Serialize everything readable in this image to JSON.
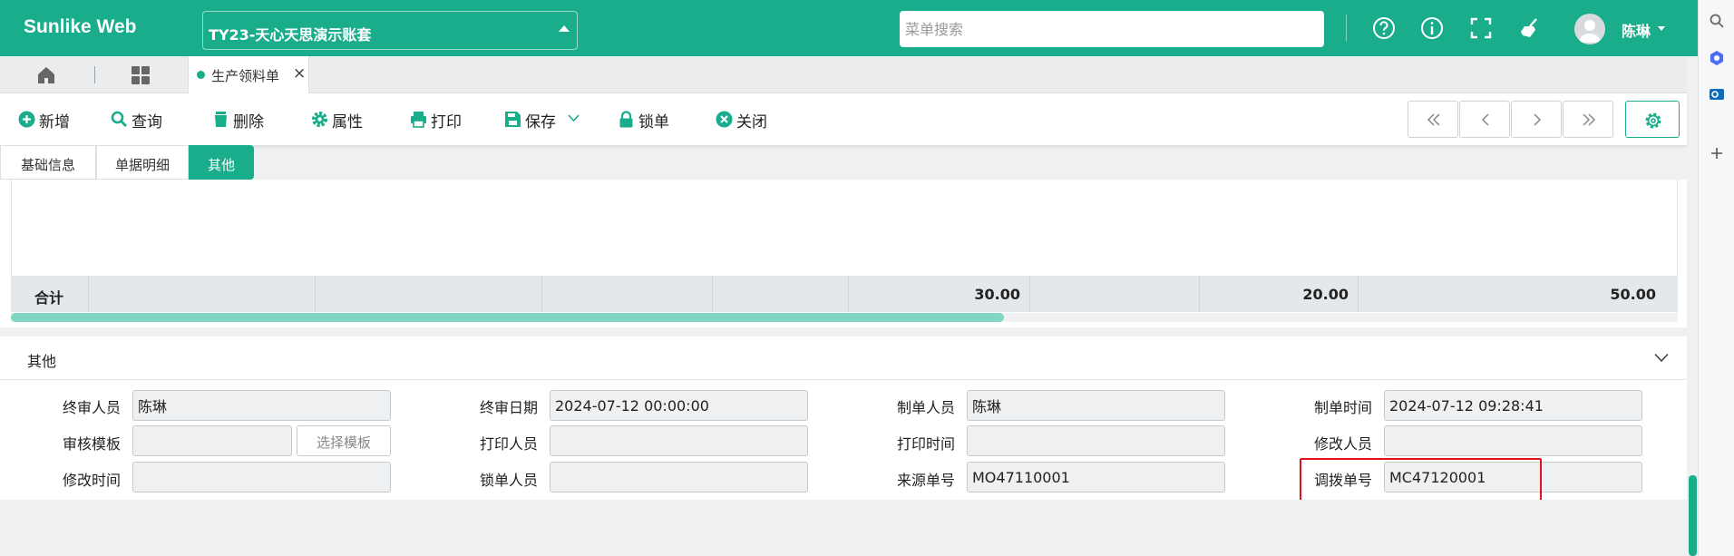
{
  "header": {
    "app_title": "Sunlike Web",
    "account_set": "TY23-天心天思演示账套",
    "search_placeholder": "菜单搜索",
    "user_name": "陈琳",
    "icons": [
      "help-icon",
      "info-icon",
      "fullscreen-icon",
      "clear-cache-icon",
      "avatar-icon"
    ]
  },
  "tabs": {
    "open_tab_label": "生产领料单",
    "close_glyph": "×"
  },
  "toolbar": {
    "new_label": "新增",
    "query_label": "查询",
    "delete_label": "删除",
    "property_label": "属性",
    "print_label": "打印",
    "save_label": "保存",
    "lock_label": "锁单",
    "close_label": "关闭"
  },
  "section_tabs": {
    "basic": "基础信息",
    "detail": "单据明细",
    "other": "其他",
    "active": "其他"
  },
  "grid": {
    "total_label": "合计",
    "total_values": [
      "30.00",
      "20.00",
      "50.00"
    ]
  },
  "other_section": {
    "title": "其他",
    "fields": {
      "final_reviewer": {
        "label": "终审人员",
        "value": "陈琳"
      },
      "final_review_date": {
        "label": "终审日期",
        "value": "2024-07-12 00:00:00"
      },
      "creator": {
        "label": "制单人员",
        "value": "陈琳"
      },
      "create_time": {
        "label": "制单时间",
        "value": "2024-07-12 09:28:41"
      },
      "review_template": {
        "label": "审核模板",
        "value": ""
      },
      "select_template_button": "选择模板",
      "printer": {
        "label": "打印人员",
        "value": ""
      },
      "print_time": {
        "label": "打印时间",
        "value": ""
      },
      "modifier": {
        "label": "修改人员",
        "value": ""
      },
      "modify_time": {
        "label": "修改时间",
        "value": ""
      },
      "locker": {
        "label": "锁单人员",
        "value": ""
      },
      "source_no": {
        "label": "来源单号",
        "value": "MO47110001"
      },
      "transfer_no": {
        "label": "调拨单号",
        "value": "MC47120001"
      }
    }
  },
  "colors": {
    "brand": "#1aad8b",
    "highlight": "#e3121a"
  }
}
